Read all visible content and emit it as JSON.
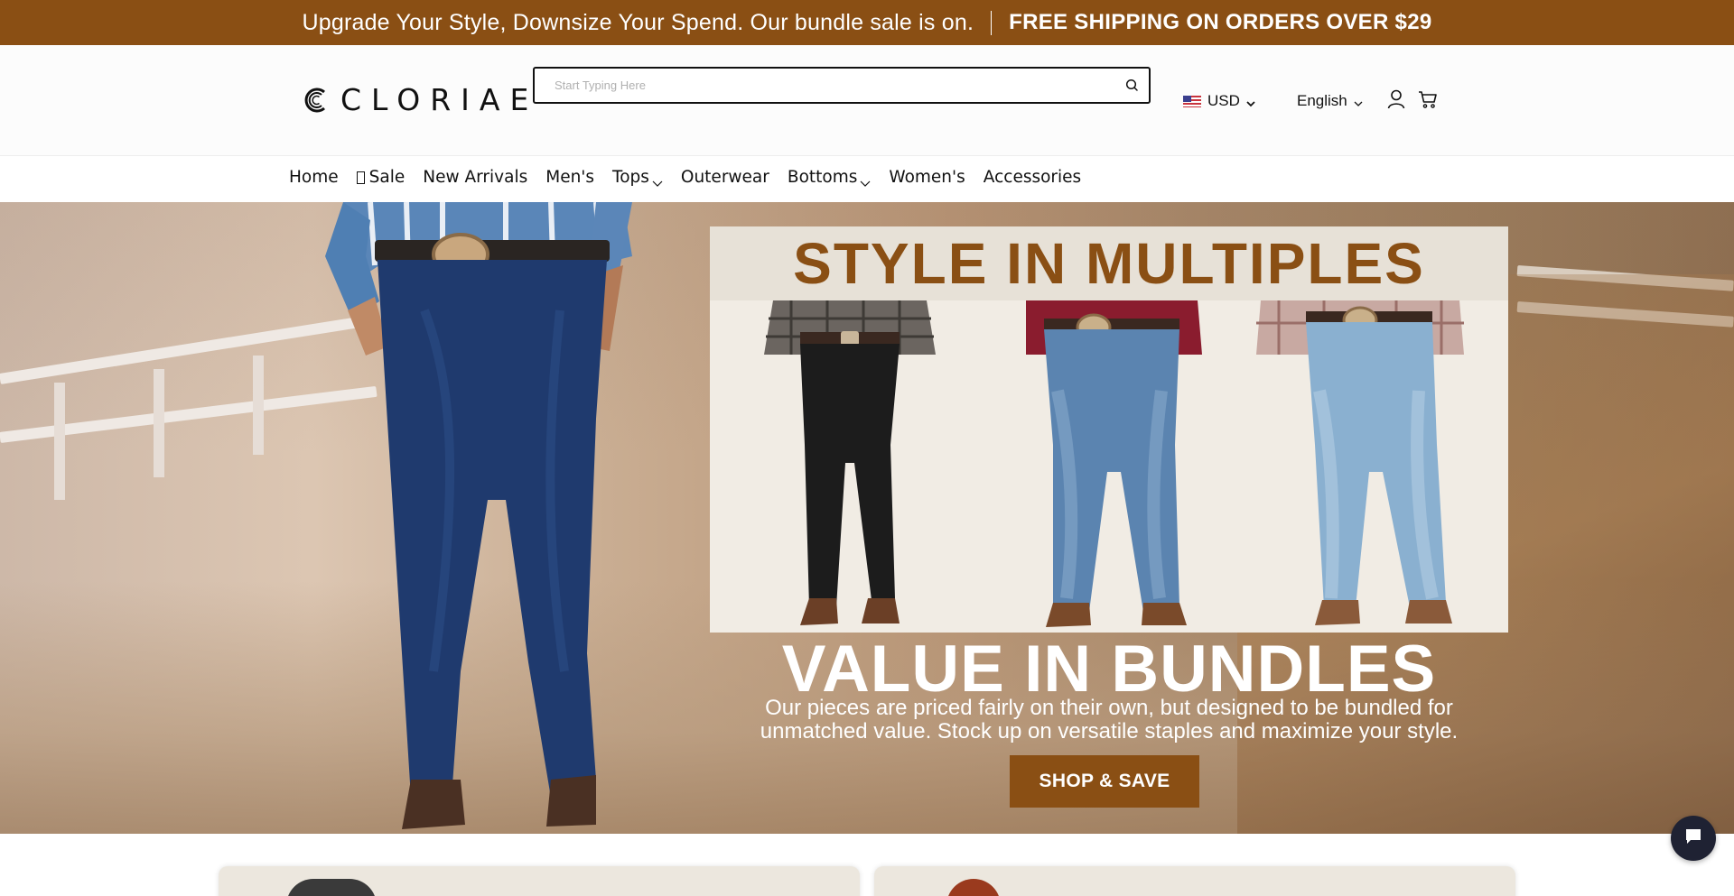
{
  "announcement": {
    "promo": "Upgrade Your Style, Downsize Your Spend. Our bundle sale is on.",
    "shipping": "FREE SHIPPING ON ORDERS OVER $29"
  },
  "header": {
    "logo": "CLORIAE",
    "search": {
      "placeholder": "Start Typing Here",
      "value": ""
    },
    "currency": "USD",
    "language": "English"
  },
  "nav": {
    "items": [
      {
        "label": "Home"
      },
      {
        "label": "Sale"
      },
      {
        "label": "New Arrivals"
      },
      {
        "label": "Men's"
      },
      {
        "label": "Tops"
      },
      {
        "label": "Outerwear"
      },
      {
        "label": "Bottoms"
      },
      {
        "label": "Women's"
      },
      {
        "label": "Accessories"
      }
    ]
  },
  "hero": {
    "panel_title": "STYLE IN MULTIPLES",
    "headline": "VALUE IN BUNDLES",
    "description": "Our pieces are priced fairly on their own, but designed to be bundled for unmatched value. Stock up on versatile staples and maximize your style.",
    "cta": "SHOP & SAVE"
  },
  "colors": {
    "brand": "#8a4f14",
    "chat": "#1f2233"
  },
  "icons": [
    "search-icon",
    "us-flag-icon",
    "chevron-down-icon",
    "user-icon",
    "cart-icon",
    "chat-icon"
  ]
}
